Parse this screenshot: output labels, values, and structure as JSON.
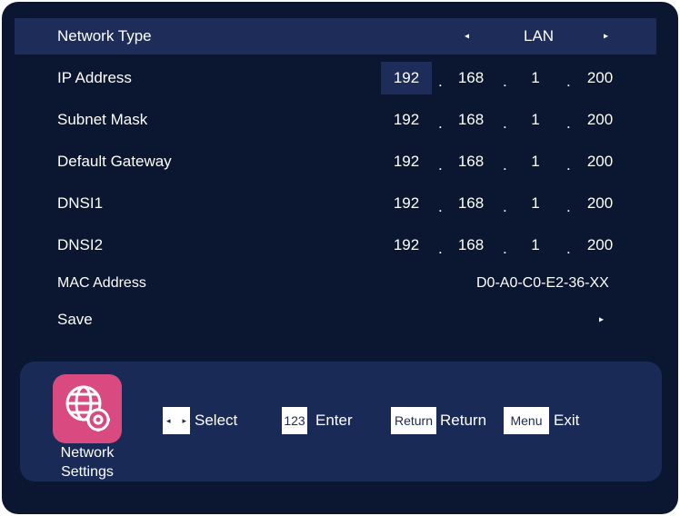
{
  "network_type": {
    "label": "Network Type",
    "value": "LAN",
    "prev_arrow": "◂",
    "next_arrow": "▸"
  },
  "fields": [
    {
      "label": "IP Address",
      "octets": [
        "192",
        "168",
        "1",
        "200"
      ]
    },
    {
      "label": "Subnet Mask",
      "octets": [
        "192",
        "168",
        "1",
        "200"
      ]
    },
    {
      "label": "Default Gateway",
      "octets": [
        "192",
        "168",
        "1",
        "200"
      ]
    },
    {
      "label": "DNSI1",
      "octets": [
        "192",
        "168",
        "1",
        "200"
      ]
    },
    {
      "label": "DNSI2",
      "octets": [
        "192",
        "168",
        "1",
        "200"
      ]
    }
  ],
  "separator": ".",
  "mac": {
    "label": "MAC Address",
    "value": "D0-A0-C0-E2-36-XX"
  },
  "save": {
    "label": "Save",
    "arrow": "▸"
  },
  "footer": {
    "app_icon": "globe-gear-icon",
    "app_label_line1": "Network",
    "app_label_line2": "Settings",
    "hints": [
      {
        "key": "◂ ▸",
        "key_icon": "left-right-arrows-icon",
        "text": "Select"
      },
      {
        "key": "123",
        "text": "Enter"
      },
      {
        "key": "Return",
        "text": "Return"
      },
      {
        "key": "Menu",
        "text": "Exit"
      }
    ]
  },
  "colors": {
    "background": "#0b1630",
    "selected_row": "#1d2c58",
    "footer": "#1a2a57",
    "app_icon": "#d94b80",
    "text": "#ffffff"
  }
}
